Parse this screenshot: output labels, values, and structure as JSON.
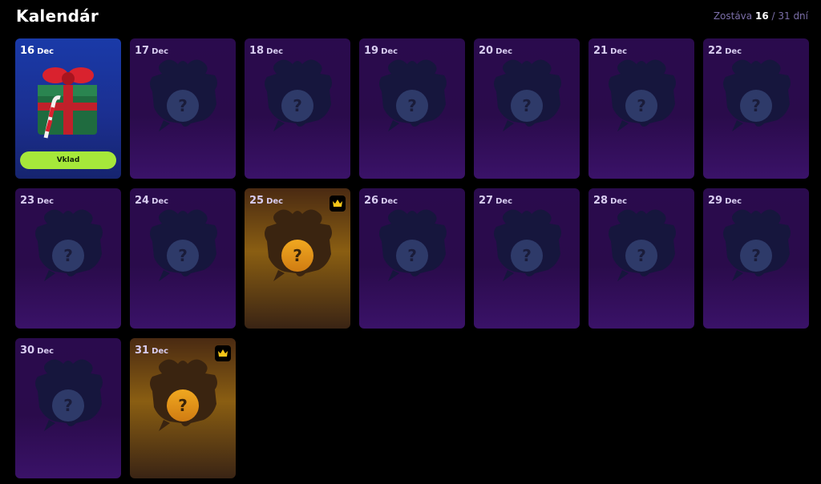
{
  "header": {
    "title": "Kalendár",
    "remaining_label": "Zostáva",
    "remaining_value": "16",
    "remaining_total": "/ 31 dní"
  },
  "colors": {
    "accent_green": "#a6e83a",
    "card_purple": "#2a0b4d",
    "today_blue": "#1a3aa8",
    "special_gold": "#8a5e12"
  },
  "cards": [
    {
      "day": "16",
      "month": "Dec",
      "state": "today",
      "button_label": "Vklad",
      "icon": "gift-icon"
    },
    {
      "day": "17",
      "month": "Dec",
      "state": "locked",
      "icon": "question-icon"
    },
    {
      "day": "18",
      "month": "Dec",
      "state": "locked",
      "icon": "question-icon"
    },
    {
      "day": "19",
      "month": "Dec",
      "state": "locked",
      "icon": "question-icon"
    },
    {
      "day": "20",
      "month": "Dec",
      "state": "locked",
      "icon": "question-icon"
    },
    {
      "day": "21",
      "month": "Dec",
      "state": "locked",
      "icon": "question-icon"
    },
    {
      "day": "22",
      "month": "Dec",
      "state": "locked",
      "icon": "question-icon"
    },
    {
      "day": "23",
      "month": "Dec",
      "state": "locked",
      "icon": "question-icon"
    },
    {
      "day": "24",
      "month": "Dec",
      "state": "locked",
      "icon": "question-icon"
    },
    {
      "day": "25",
      "month": "Dec",
      "state": "special",
      "icon": "question-icon",
      "badge": "crown-icon"
    },
    {
      "day": "26",
      "month": "Dec",
      "state": "locked",
      "icon": "question-icon"
    },
    {
      "day": "27",
      "month": "Dec",
      "state": "locked",
      "icon": "question-icon"
    },
    {
      "day": "28",
      "month": "Dec",
      "state": "locked",
      "icon": "question-icon"
    },
    {
      "day": "29",
      "month": "Dec",
      "state": "locked",
      "icon": "question-icon"
    },
    {
      "day": "30",
      "month": "Dec",
      "state": "locked",
      "icon": "question-icon"
    },
    {
      "day": "31",
      "month": "Dec",
      "state": "special",
      "icon": "question-icon",
      "badge": "crown-icon"
    }
  ],
  "question_glyph": "?"
}
